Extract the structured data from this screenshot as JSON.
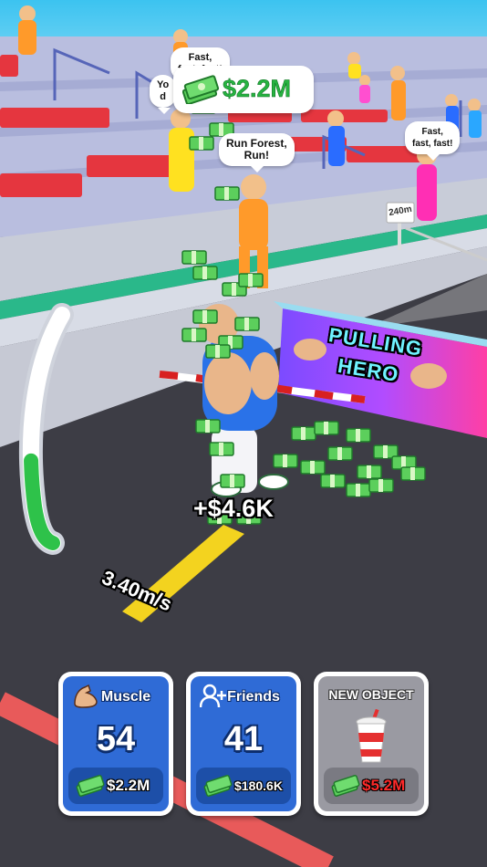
{
  "hud": {
    "cash_total": "$2.2M",
    "earn_popup": "+$4.6K",
    "speed": "3.40m/s",
    "power_meter_level": 0.37
  },
  "scene": {
    "banner_line1": "PULLING",
    "banner_line2": "HERO",
    "distance_sign": "240m",
    "speech_bubbles": [
      {
        "text": "Fast,\nfast, fast!"
      },
      {
        "text": "Yo\nd"
      },
      {
        "text": "Run Forest,\nRun!"
      },
      {
        "text": "Fast,\nfast, fast!"
      }
    ]
  },
  "upgrades": [
    {
      "title": "Muscle",
      "value": "54",
      "price": "$2.2M",
      "icon": "flexed-bicep-icon",
      "state": "available"
    },
    {
      "title": "Friends",
      "value": "41",
      "price": "$180.6K",
      "icon": "add-friend-icon",
      "state": "available"
    },
    {
      "title": "NEW OBJECT",
      "price": "$5.2M",
      "icon": "drink-cup-icon",
      "state": "locked"
    }
  ],
  "colors": {
    "card_blue": "#2f6bd6",
    "card_grey": "#9a9aa2",
    "money_green": "#27b341",
    "price_locked_red": "#ff2a2a",
    "meter_green": "#2ec24a"
  }
}
